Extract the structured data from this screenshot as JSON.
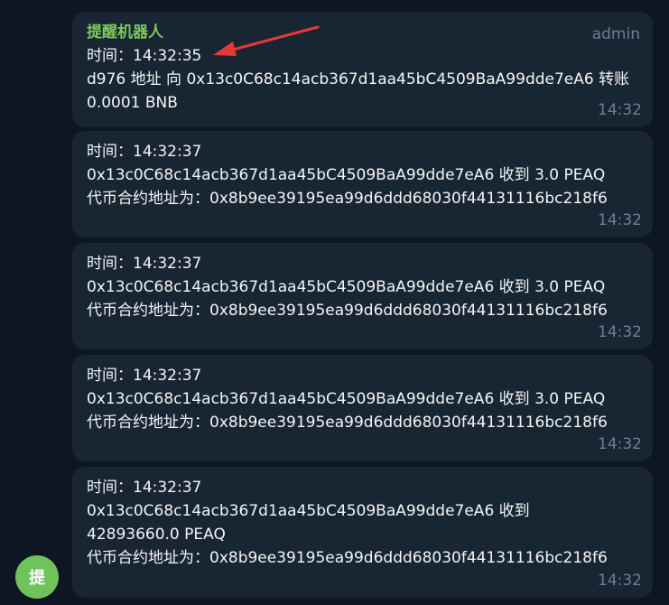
{
  "sender": {
    "name": "提醒机器人",
    "role": "admin",
    "avatar_text": "提"
  },
  "messages": [
    {
      "lines": [
        "时间：14:32:35",
        " d976 地址 向 0x13c0C68c14acb367d1aa45bC4509BaA99dde7eA6 转账 0.0001 BNB"
      ],
      "time": "14:32"
    },
    {
      "lines": [
        "时间：14:32:37",
        "0x13c0C68c14acb367d1aa45bC4509BaA99dde7eA6 收到 3.0 PEAQ",
        "代币合约地址为：0x8b9ee39195ea99d6ddd68030f44131116bc218f6"
      ],
      "time": "14:32"
    },
    {
      "lines": [
        "时间：14:32:37",
        "0x13c0C68c14acb367d1aa45bC4509BaA99dde7eA6 收到 3.0 PEAQ",
        "代币合约地址为：0x8b9ee39195ea99d6ddd68030f44131116bc218f6"
      ],
      "time": "14:32"
    },
    {
      "lines": [
        "时间：14:32:37",
        "0x13c0C68c14acb367d1aa45bC4509BaA99dde7eA6 收到 3.0 PEAQ",
        "代币合约地址为：0x8b9ee39195ea99d6ddd68030f44131116bc218f6"
      ],
      "time": "14:32"
    },
    {
      "lines": [
        "时间：14:32:37",
        "0x13c0C68c14acb367d1aa45bC4509BaA99dde7eA6 收到",
        "42893660.0 PEAQ",
        "代币合约地址为：0x8b9ee39195ea99d6ddd68030f44131116bc218f6"
      ],
      "time": "14:32"
    }
  ],
  "colors": {
    "background": "#0e1621",
    "bubble": "#182533",
    "sender_name": "#7bc862",
    "meta": "#6d7f8f",
    "avatar": "#6fc35a",
    "annotation_arrow": "#e53935"
  },
  "icons": {
    "annotation": "red-arrow-icon"
  }
}
